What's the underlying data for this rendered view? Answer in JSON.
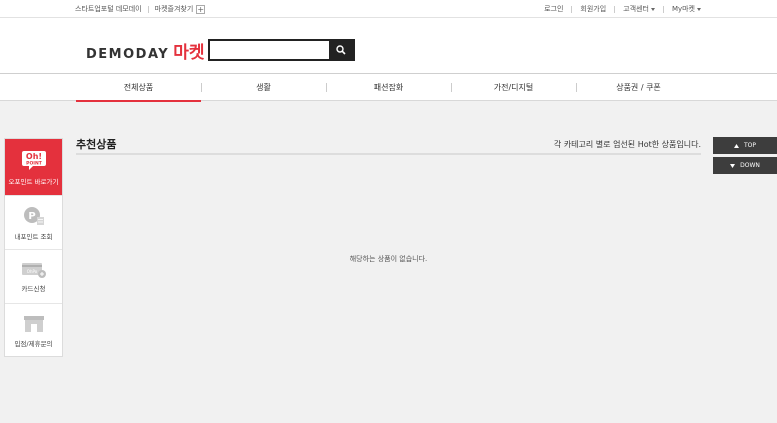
{
  "topbar": {
    "startpage": "스타트업포털 데모데이",
    "favorite": "마켓즐겨찾기",
    "plus": "+",
    "login": "로그인",
    "join": "회원가입",
    "cs": "고객센터",
    "mymarket": "My마켓"
  },
  "header": {
    "logo_en": "DEMODAY",
    "logo_ko": "마켓",
    "search_placeholder": "",
    "search_value": ""
  },
  "nav": {
    "items": [
      {
        "label": "전체상품"
      },
      {
        "label": "생활"
      },
      {
        "label": "패션잡화"
      },
      {
        "label": "가전/디지털"
      },
      {
        "label": "상품권 / 쿠폰"
      }
    ],
    "active_index": 0
  },
  "quick": {
    "point_badge_top": "Oh!",
    "point_badge_bottom": "POINT",
    "items": [
      {
        "label": "오포인트 바로가기"
      },
      {
        "label": "내포인트 조회"
      },
      {
        "label": "카드신청"
      },
      {
        "label": "입점/제휴문의"
      }
    ],
    "card_badge": "OhPo"
  },
  "main": {
    "title": "추천상품",
    "description": "각 카테고리 별로 엄선된 Hot한 상품입니다.",
    "empty_message": "해당하는 상품이 없습니다."
  },
  "scroll": {
    "top": "TOP",
    "down": "DOWN"
  },
  "colors": {
    "accent": "#e4313d",
    "dark": "#3d3d3d"
  }
}
